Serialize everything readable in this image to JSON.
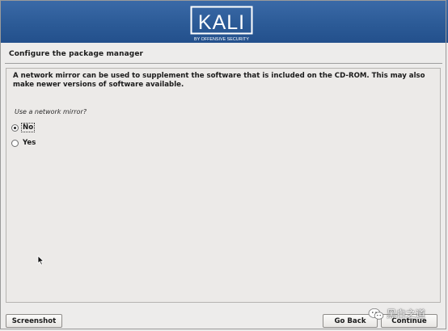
{
  "banner": {
    "logo_word": "KALI",
    "logo_tagline": "BY OFFENSIVE SECURITY"
  },
  "page_title": "Configure the package manager",
  "description": "A network mirror can be used to supplement the software that is included on the CD-ROM. This may also make newer versions of software available.",
  "question": "Use a network mirror?",
  "options": [
    {
      "label": "No",
      "selected": true
    },
    {
      "label": "Yes",
      "selected": false
    }
  ],
  "buttons": {
    "screenshot": "Screenshot",
    "go_back": "Go Back",
    "continue": "Continue"
  },
  "watermark": {
    "text": "黑白之道",
    "icon": "wechat-icon"
  },
  "colors": {
    "banner": "#2c5b97",
    "background": "#edeceb"
  }
}
